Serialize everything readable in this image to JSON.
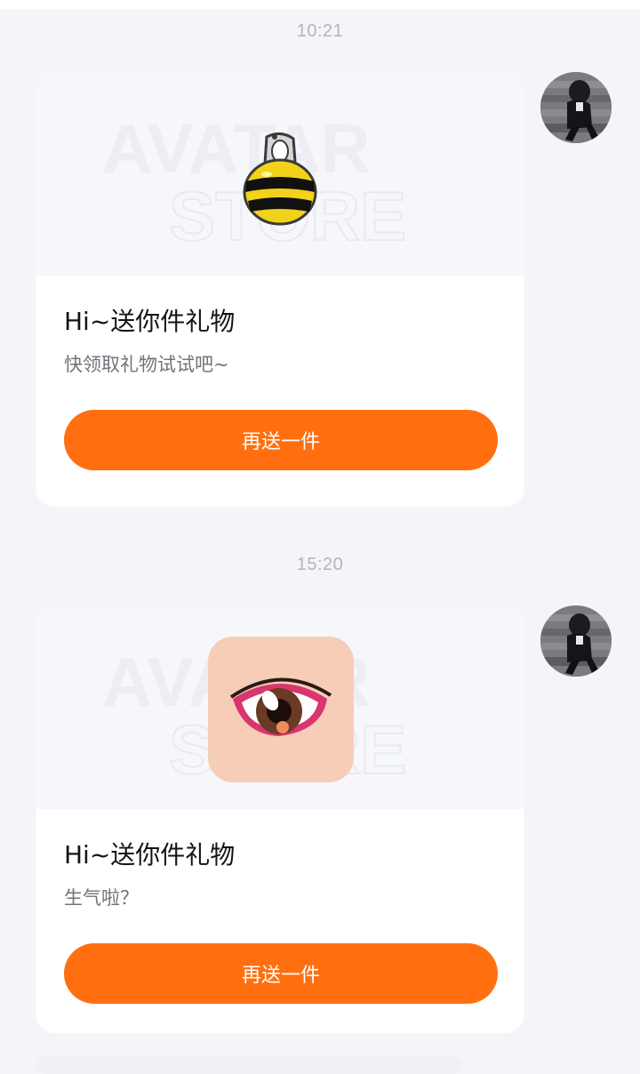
{
  "messages": [
    {
      "timestamp": "10:21",
      "watermark_lines": [
        "AVATAR",
        "STORE"
      ],
      "gift_icon": "bee-nail-icon",
      "title": "Hi~送你件礼物",
      "subtitle": "快领取礼物试试吧~",
      "button_label": "再送一件"
    },
    {
      "timestamp": "15:20",
      "watermark_lines": [
        "AVATAR",
        "STORE"
      ],
      "gift_icon": "eye-makeup-icon",
      "title": "Hi~送你件礼物",
      "subtitle": "生气啦？",
      "button_label": "再送一件"
    }
  ],
  "colors": {
    "accent": "#ff6f10",
    "page_bg": "#f4f5f8",
    "card_bg": "#ffffff"
  }
}
